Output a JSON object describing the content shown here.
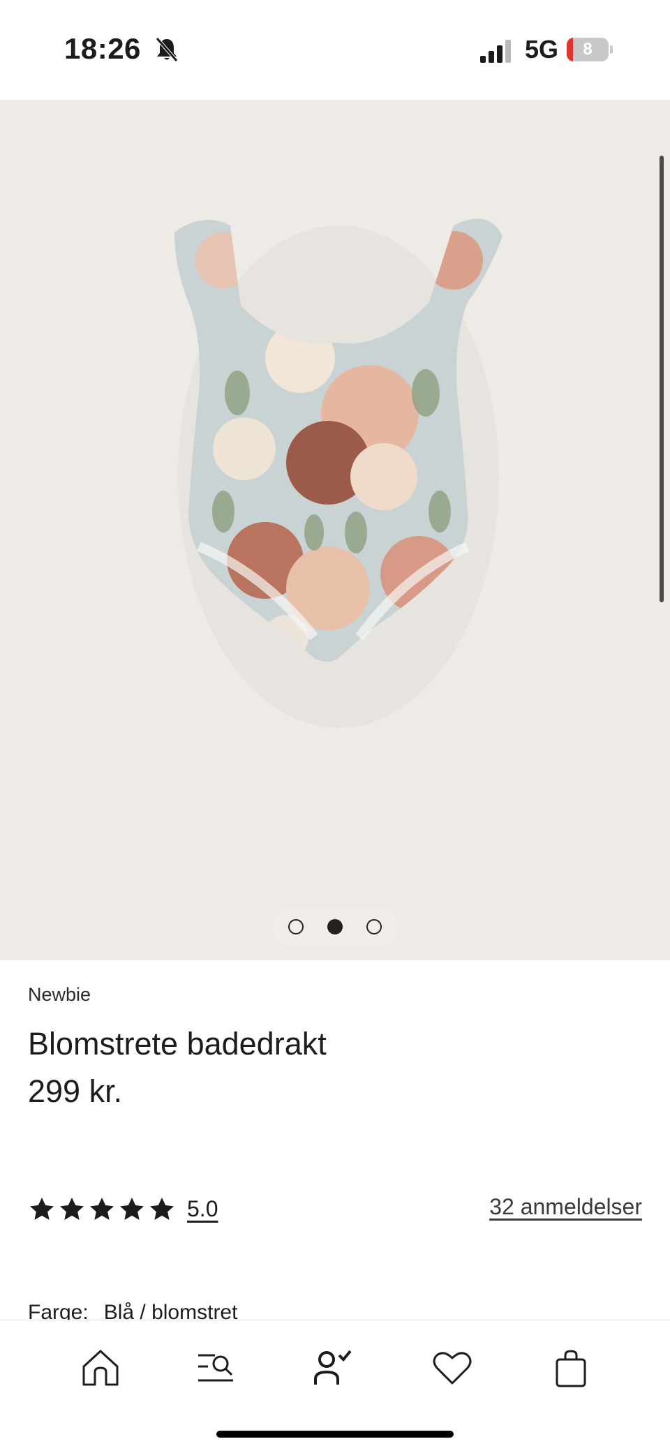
{
  "status_bar": {
    "time": "18:26",
    "network": "5G",
    "battery_level": "8",
    "battery_color": "#e0362f",
    "icons": [
      "bell-slash-icon",
      "signal-icon",
      "battery-icon"
    ]
  },
  "product_gallery": {
    "image_description_icon": "floral-swimsuit-image",
    "slide_count": 3,
    "active_slide": 2
  },
  "product": {
    "brand": "Newbie",
    "title": "Blomstrete badedrakt",
    "price": "299 kr.",
    "rating_stars": 5,
    "rating_value": "5.0",
    "reviews_link": "32 anmeldelser",
    "color_label": "Farge:",
    "color_value": "Blå / blomstret"
  },
  "bottom_nav": {
    "items": [
      "home-icon",
      "search-filter-icon",
      "account-icon",
      "heart-icon",
      "shopping-bag-icon"
    ]
  }
}
